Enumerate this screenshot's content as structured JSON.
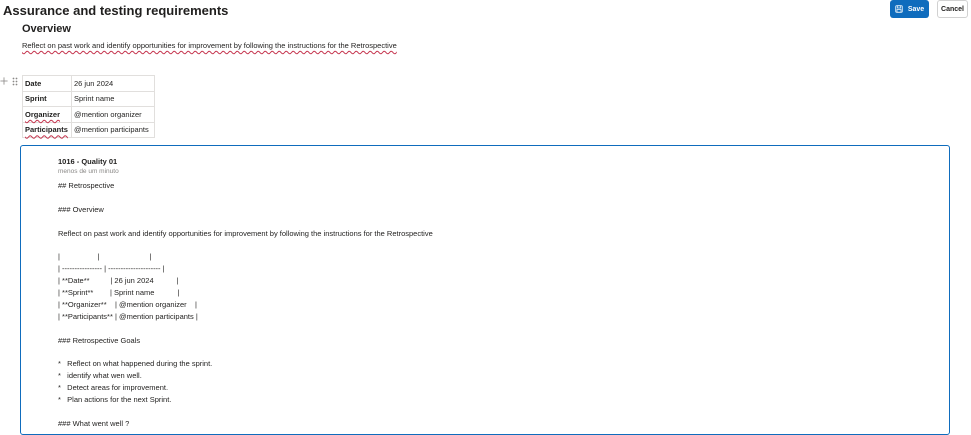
{
  "header": {
    "title": "Assurance and testing requirements",
    "save_label": "Save",
    "cancel_label": "Cancel"
  },
  "overview": {
    "heading": "Overview",
    "text": "Reflect on past work and identify opportunities for improvement by following the instructions for the Retrospective"
  },
  "meta_table": [
    {
      "key": "Date",
      "value": "26 jun 2024"
    },
    {
      "key": "Sprint",
      "value": "Sprint name"
    },
    {
      "key": "Organizer",
      "value": "@mention organizer"
    },
    {
      "key": "Participants",
      "value": "@mention participants"
    }
  ],
  "comment": {
    "author": "1016 - Quality 01",
    "time": "menos de um minuto",
    "lines": [
      "## Retrospective",
      "",
      "### Overview",
      "",
      "Reflect on past work and identify opportunities for improvement by following the instructions for the Retrospective",
      "",
      "|                  |                        |",
      "| ---------------- | --------------------- |",
      "| **Date**          | 26 jun 2024           |",
      "| **Sprint**        | Sprint name           |",
      "| **Organizer**    | @mention organizer    |",
      "| **Participants** | @mention participants |",
      "",
      "### Retrospective Goals",
      "",
      "*   Reflect on what happened during the sprint.",
      "*   identify what wen well.",
      "*   Detect areas for improvement.",
      "*   Plan actions for the next Sprint.",
      "",
      "### What went well ?"
    ]
  },
  "colors": {
    "accent": "#0f6cbd",
    "spellcheck": "#c4314b"
  },
  "icons": [
    "save-icon",
    "plus-icon",
    "drag-handle-icon"
  ]
}
